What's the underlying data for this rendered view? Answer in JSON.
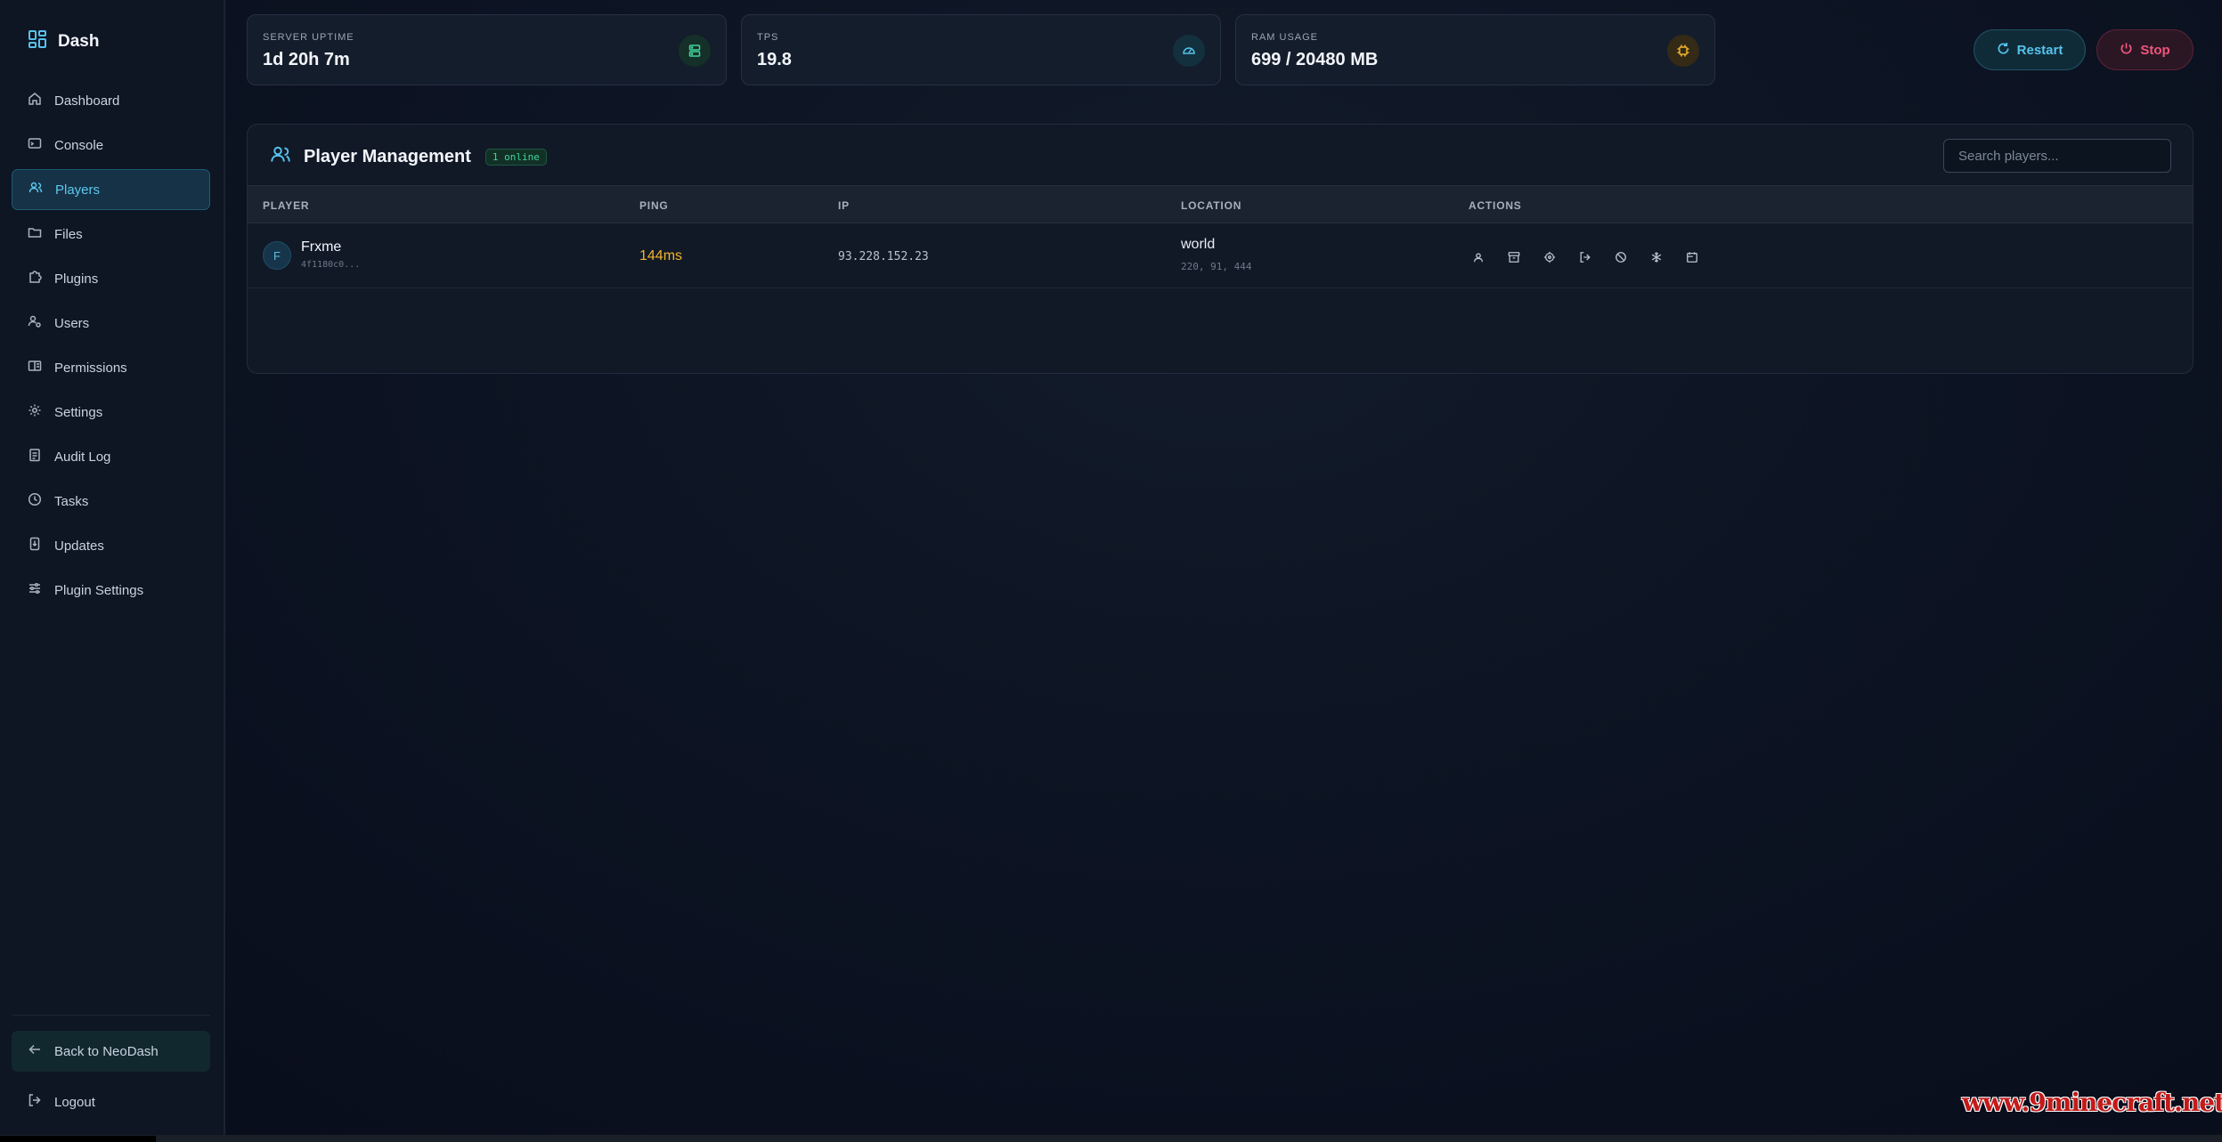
{
  "brand": {
    "title": "Dash"
  },
  "sidebar": {
    "items": [
      {
        "label": "Dashboard",
        "icon": "home-icon"
      },
      {
        "label": "Console",
        "icon": "terminal-icon"
      },
      {
        "label": "Players",
        "icon": "users-icon",
        "active": true
      },
      {
        "label": "Files",
        "icon": "folder-icon"
      },
      {
        "label": "Plugins",
        "icon": "puzzle-icon"
      },
      {
        "label": "Users",
        "icon": "user-cog-icon"
      },
      {
        "label": "Permissions",
        "icon": "book-icon"
      },
      {
        "label": "Settings",
        "icon": "gear-icon"
      },
      {
        "label": "Audit Log",
        "icon": "clipboard-icon"
      },
      {
        "label": "Tasks",
        "icon": "clock-icon"
      },
      {
        "label": "Updates",
        "icon": "download-icon"
      },
      {
        "label": "Plugin Settings",
        "icon": "sliders-icon"
      }
    ],
    "back_label": "Back to NeoDash",
    "logout_label": "Logout"
  },
  "stats": [
    {
      "label": "SERVER UPTIME",
      "value": "1d 20h 7m",
      "icon": "server-icon",
      "color": "#3fd59a"
    },
    {
      "label": "TPS",
      "value": "19.8",
      "icon": "gauge-icon",
      "color": "#55c3ec"
    },
    {
      "label": "RAM USAGE",
      "value": "699 / 20480 MB",
      "icon": "cpu-icon",
      "color": "#f2b42c"
    }
  ],
  "controls": {
    "restart_label": "Restart",
    "stop_label": "Stop"
  },
  "panel": {
    "title": "Player Management",
    "online_badge": "1 online",
    "search_placeholder": "Search players...",
    "columns": [
      "PLAYER",
      "PING",
      "IP",
      "LOCATION",
      "ACTIONS"
    ],
    "rows": [
      {
        "initial": "F",
        "name": "Frxme",
        "uuid": "4f1180c0...",
        "ping": "144ms",
        "ip": "93.228.152.23",
        "world": "world",
        "coords": "220, 91, 444",
        "actions": [
          "profile-icon",
          "inventory-icon",
          "teleport-icon",
          "kick-icon",
          "ban-icon",
          "freeze-icon",
          "gamemode-icon"
        ]
      }
    ]
  },
  "watermark": "www.9minecraft.net",
  "colors": {
    "accent": "#55c3ec",
    "danger": "#f0567e",
    "success": "#3fd59a",
    "warning": "#f2b42c"
  }
}
